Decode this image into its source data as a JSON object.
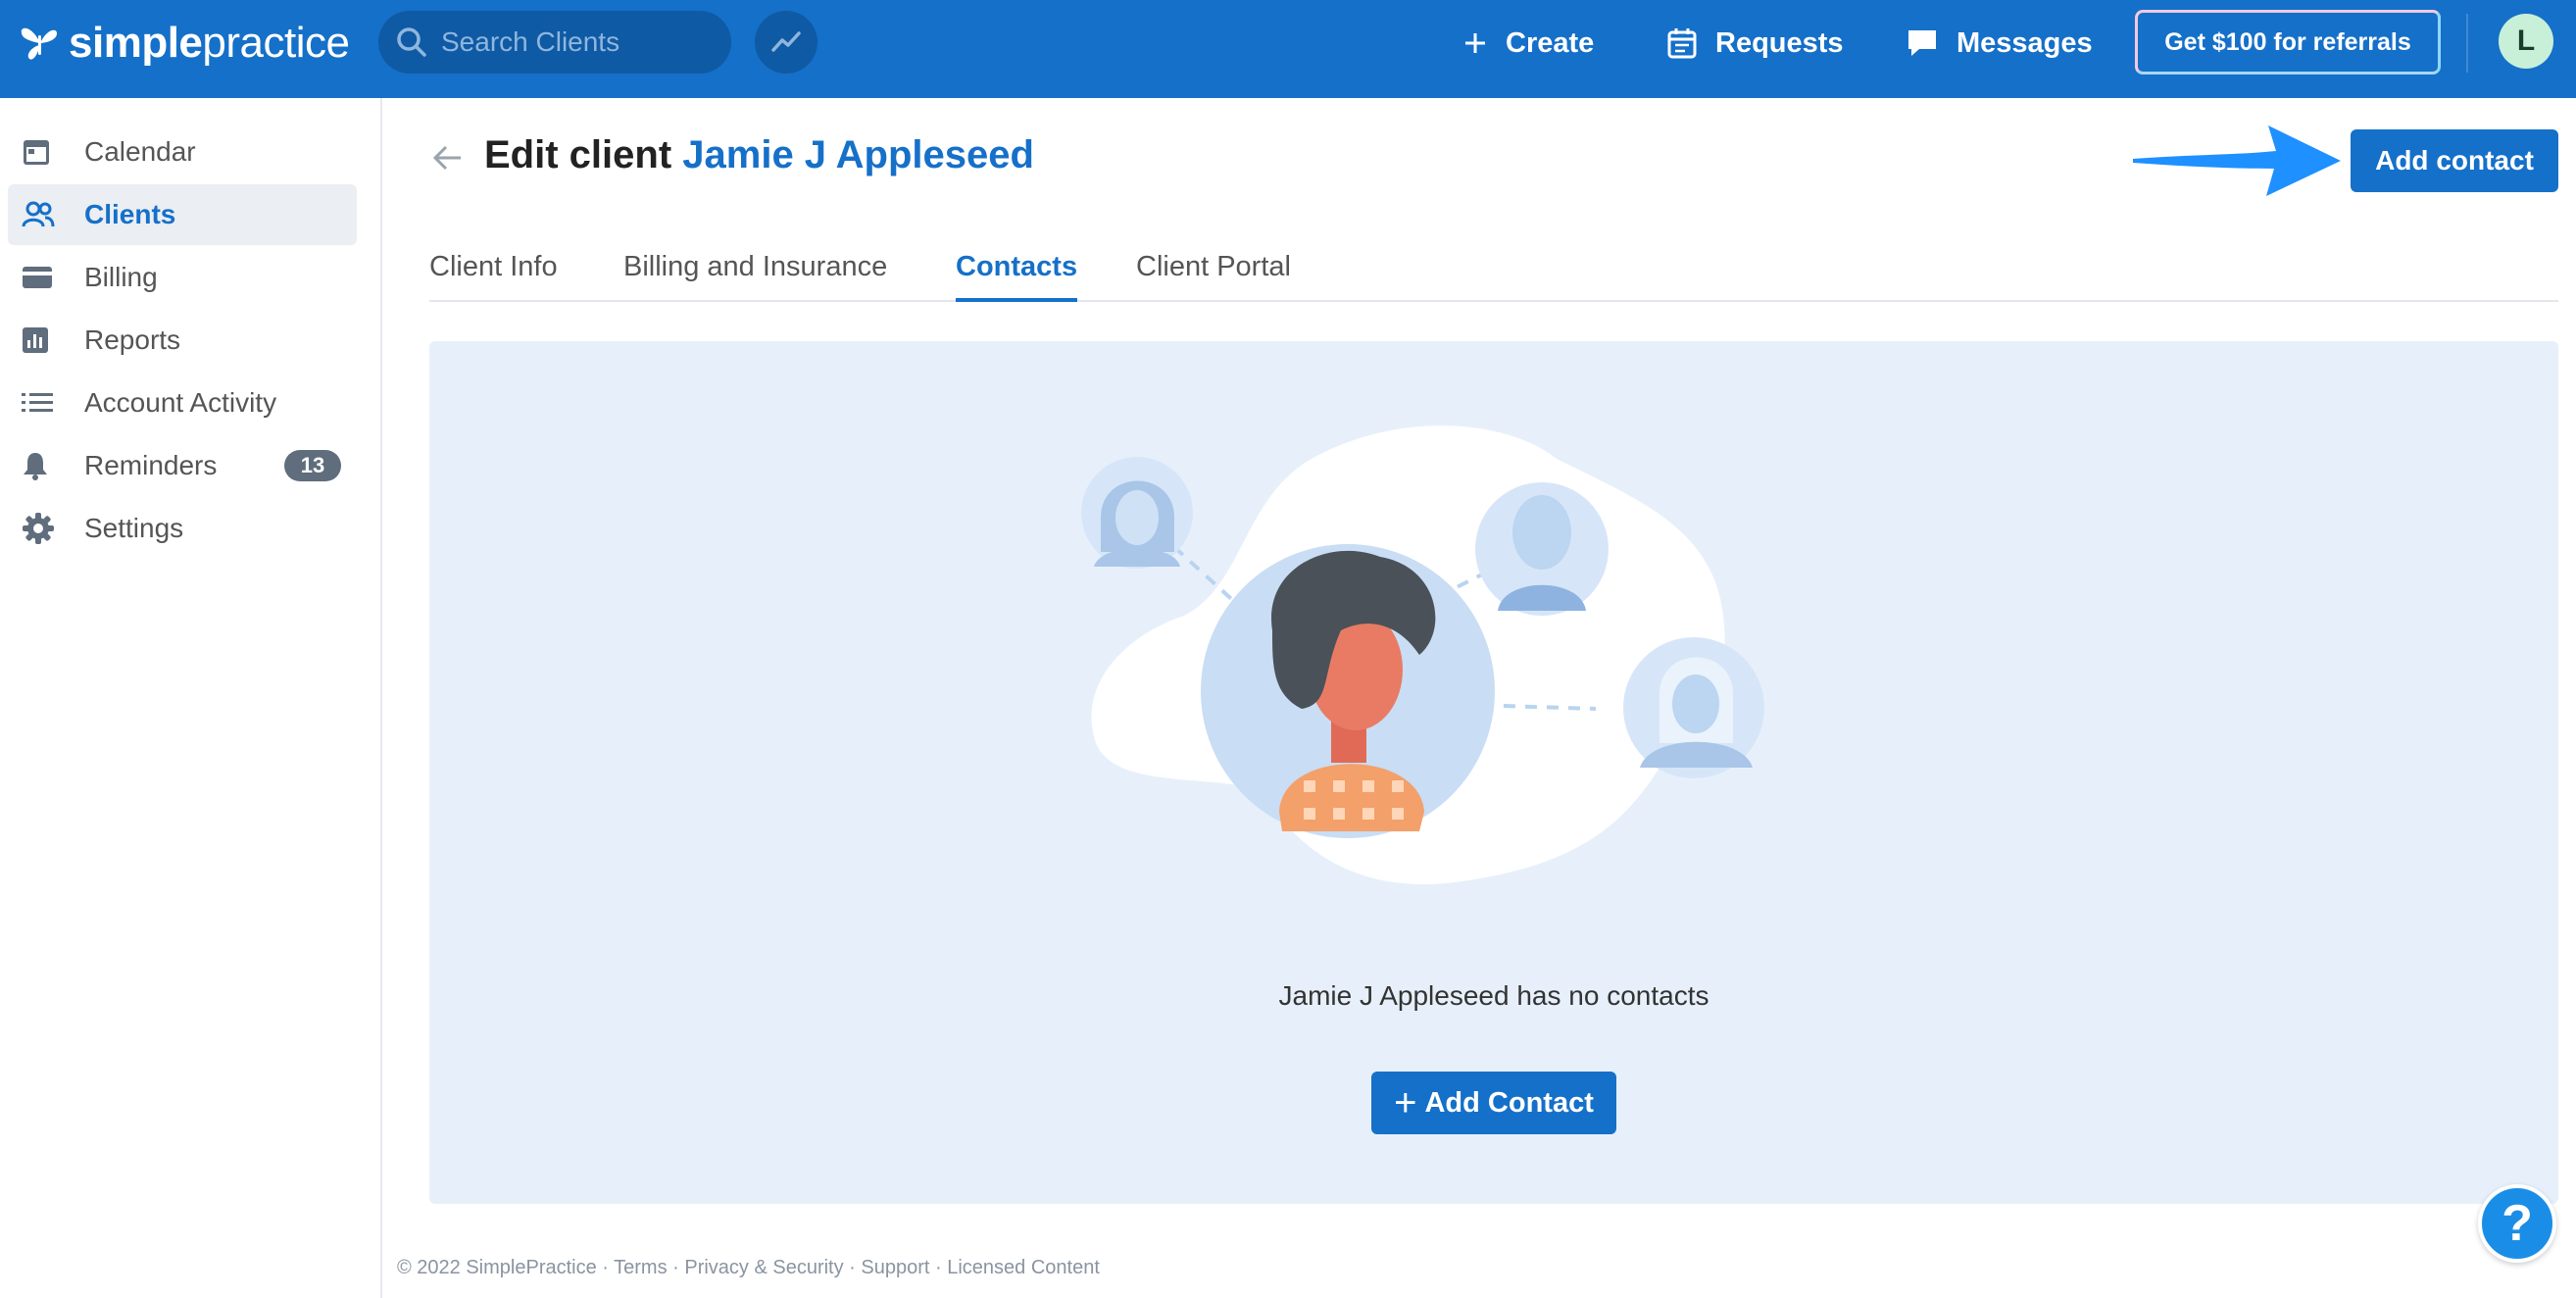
{
  "topbar": {
    "logo_bold": "simple",
    "logo_light": "practice",
    "search_placeholder": "Search Clients",
    "create_label": "Create",
    "requests_label": "Requests",
    "messages_label": "Messages",
    "referral_label": "Get $100 for referrals",
    "avatar_initial": "L"
  },
  "sidebar": {
    "items": [
      {
        "label": "Calendar",
        "icon": "calendar-icon"
      },
      {
        "label": "Clients",
        "icon": "clients-icon",
        "active": true
      },
      {
        "label": "Billing",
        "icon": "billing-icon"
      },
      {
        "label": "Reports",
        "icon": "reports-icon"
      },
      {
        "label": "Account Activity",
        "icon": "list-icon"
      },
      {
        "label": "Reminders",
        "icon": "bell-icon",
        "badge": "13"
      },
      {
        "label": "Settings",
        "icon": "gear-icon"
      }
    ]
  },
  "header": {
    "title_prefix": "Edit client",
    "client_name": "Jamie J Appleseed",
    "add_contact_label": "Add contact"
  },
  "tabs": [
    {
      "label": "Client Info"
    },
    {
      "label": "Billing and Insurance"
    },
    {
      "label": "Contacts",
      "active": true
    },
    {
      "label": "Client Portal"
    }
  ],
  "empty_state": {
    "message": "Jamie J Appleseed has no contacts",
    "button_label": "Add Contact"
  },
  "footer": {
    "text": "© 2022 SimplePractice · Terms · Privacy & Security · Support · Licensed Content"
  },
  "help": {
    "label": "?"
  },
  "colors": {
    "brand": "#1570c9",
    "panel_bg": "#e7f0fa",
    "annotation_arrow": "#1e90ff"
  }
}
